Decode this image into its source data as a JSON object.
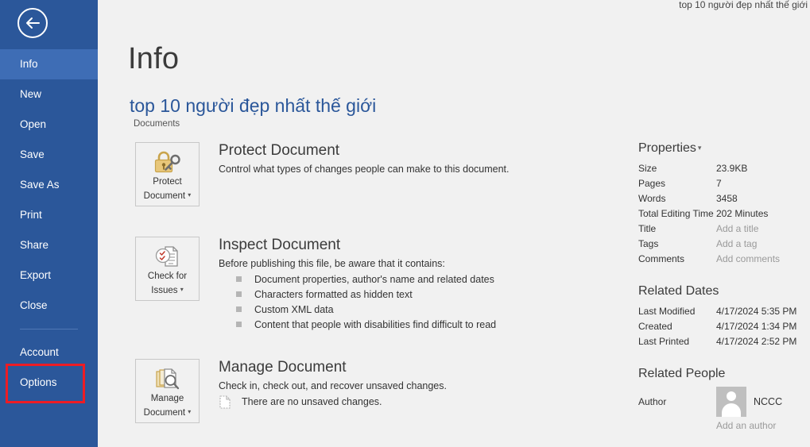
{
  "window": {
    "corner_title": "top 10 người đẹp nhất thế giới",
    "accent_color": "#2b579a",
    "highlight_color": "#ed1c24",
    "background_color": "#f1f1f1"
  },
  "sidebar": {
    "back_icon": "back-arrow-icon",
    "items": [
      {
        "label": "Info",
        "selected": true
      },
      {
        "label": "New",
        "selected": false
      },
      {
        "label": "Open",
        "selected": false
      },
      {
        "label": "Save",
        "selected": false
      },
      {
        "label": "Save As",
        "selected": false
      },
      {
        "label": "Print",
        "selected": false
      },
      {
        "label": "Share",
        "selected": false
      },
      {
        "label": "Export",
        "selected": false
      },
      {
        "label": "Close",
        "selected": false
      }
    ],
    "bottom_items": [
      {
        "label": "Account",
        "highlighted": false
      },
      {
        "label": "Options",
        "highlighted": true
      }
    ]
  },
  "main": {
    "page_title": "Info",
    "document_name": "top 10 người đẹp nhất thế giới",
    "document_location": "Documents",
    "cards": [
      {
        "button_label_line1": "Protect",
        "button_label_line2": "Document",
        "button_icon": "lock-and-key-icon",
        "has_caret": true,
        "title": "Protect Document",
        "description": "Control what types of changes people can make to this document.",
        "bullets": [],
        "note": null
      },
      {
        "button_label_line1": "Check for",
        "button_label_line2": "Issues",
        "button_icon": "document-checklist-icon",
        "has_caret": true,
        "title": "Inspect Document",
        "description": "Before publishing this file, be aware that it contains:",
        "bullets": [
          "Document properties, author's name and related dates",
          "Characters formatted as hidden text",
          "Custom XML data",
          "Content that people with disabilities find difficult to read"
        ],
        "note": null
      },
      {
        "button_label_line1": "Manage",
        "button_label_line2": "Document",
        "button_icon": "documents-magnifier-icon",
        "has_caret": true,
        "title": "Manage Document",
        "description": "Check in, check out, and recover unsaved changes.",
        "bullets": [],
        "note": "There are no unsaved changes."
      }
    ]
  },
  "properties": {
    "heading": "Properties",
    "rows": [
      {
        "key": "Size",
        "value": "23.9KB",
        "placeholder": false
      },
      {
        "key": "Pages",
        "value": "7",
        "placeholder": false
      },
      {
        "key": "Words",
        "value": "3458",
        "placeholder": false
      },
      {
        "key": "Total Editing Time",
        "value": "202 Minutes",
        "placeholder": false
      },
      {
        "key": "Title",
        "value": "Add a title",
        "placeholder": true
      },
      {
        "key": "Tags",
        "value": "Add a tag",
        "placeholder": true
      },
      {
        "key": "Comments",
        "value": "Add comments",
        "placeholder": true
      }
    ]
  },
  "related_dates": {
    "heading": "Related Dates",
    "rows": [
      {
        "key": "Last Modified",
        "value": "4/17/2024 5:35 PM"
      },
      {
        "key": "Created",
        "value": "4/17/2024 1:34 PM"
      },
      {
        "key": "Last Printed",
        "value": "4/17/2024 2:52 PM"
      }
    ]
  },
  "related_people": {
    "heading": "Related People",
    "author_key": "Author",
    "author_name": "NCCC",
    "add_author": "Add an author"
  }
}
